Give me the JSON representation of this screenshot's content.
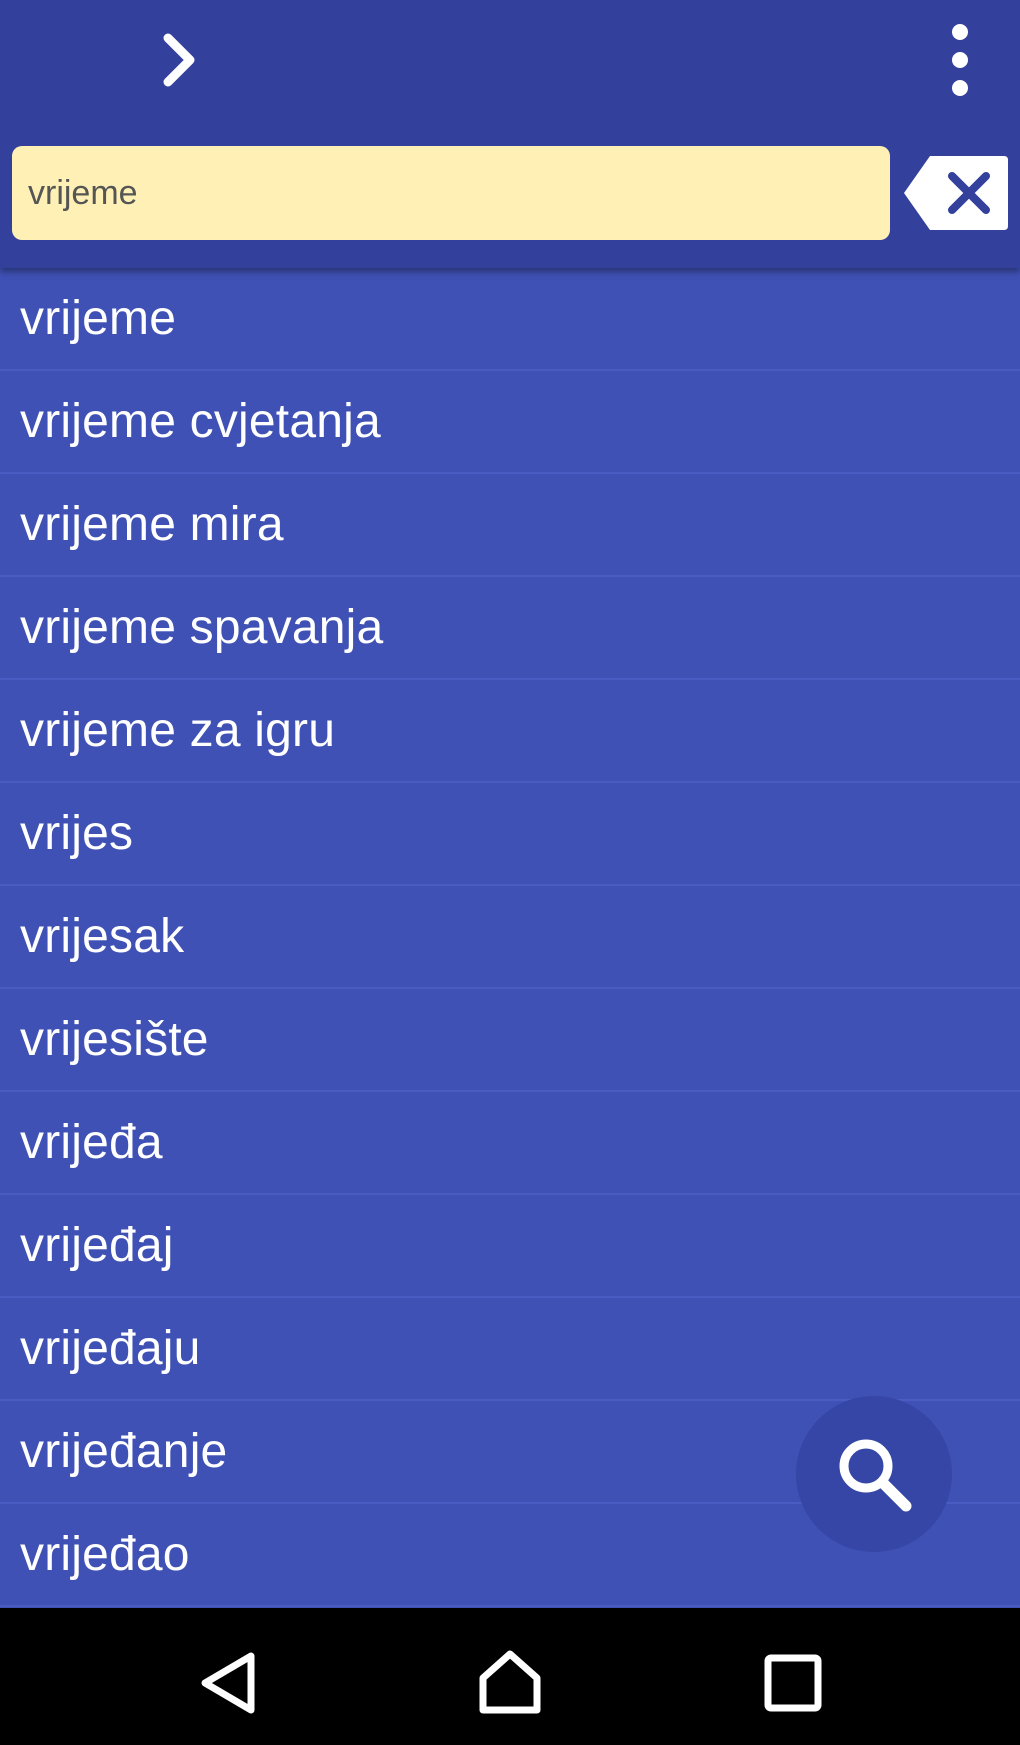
{
  "search": {
    "value": "vrijeme"
  },
  "results": [
    "vrijeme",
    "vrijeme cvjetanja",
    "vrijeme mira",
    "vrijeme spavanja",
    "vrijeme za igru",
    "vrijes",
    "vrijesak",
    "vrijesište",
    "vrijeđa",
    "vrijeđaj",
    "vrijeđaju",
    "vrijeđanje",
    "vrijeđao"
  ],
  "icons": {
    "forward": "chevron-right-icon",
    "overflow": "more-vert-icon",
    "clear": "backspace-clear-icon",
    "search": "search-icon",
    "nav_back": "triangle-back-icon",
    "nav_home": "home-icon",
    "nav_recents": "square-recents-icon"
  },
  "colors": {
    "appbar": "#33409c",
    "list_bg": "#3f51b5",
    "search_bg": "#fff1b5",
    "fab": "#3546a6"
  }
}
